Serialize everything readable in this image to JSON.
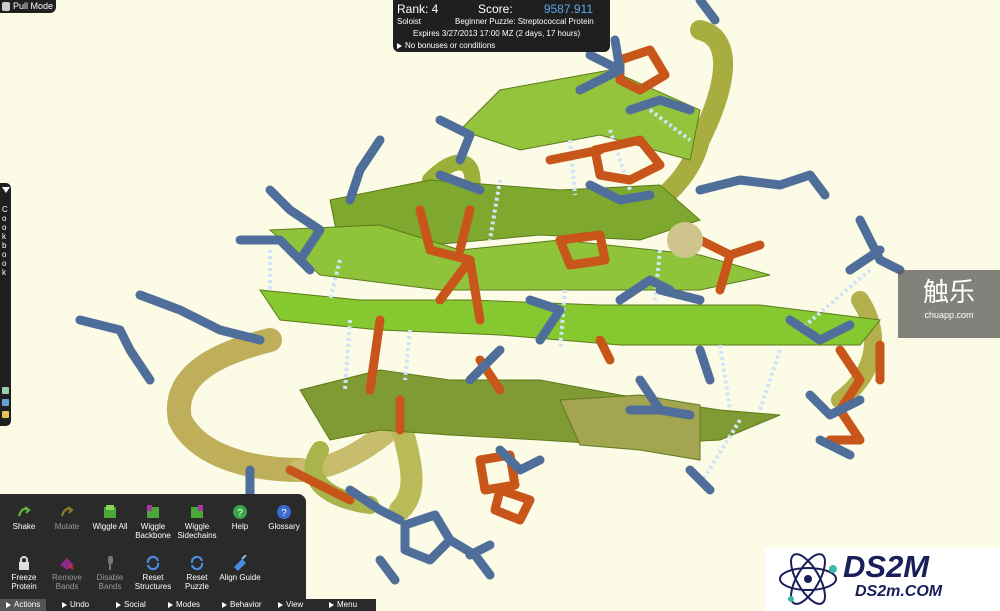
{
  "pull_mode": {
    "label": "Pull Mode"
  },
  "puzzle": {
    "rank_label": "Rank: 4",
    "score_label": "Score:",
    "score_value": "9587.911",
    "mode": "Soloist",
    "title": "Beginner Puzzle: Streptococcal Protein",
    "expires": "Expires 3/27/2013 17:00 MZ (2 days, 17 hours)",
    "bonus": "No bonuses or conditions"
  },
  "cookbook": {
    "label": "Cookbook"
  },
  "tools": [
    {
      "label": "Shake",
      "icon": "shake-icon"
    },
    {
      "label": "Mutate",
      "icon": "mutate-icon"
    },
    {
      "label": "Wiggle All",
      "icon": "wiggle-all-icon"
    },
    {
      "label": "Wiggle Backbone",
      "icon": "wiggle-backbone-icon"
    },
    {
      "label": "Wiggle Sidechains",
      "icon": "wiggle-sidechains-icon"
    },
    {
      "label": "Help",
      "icon": "help-icon"
    },
    {
      "label": "Glossary",
      "icon": "glossary-icon"
    },
    {
      "label": "Freeze Protein",
      "icon": "freeze-icon"
    },
    {
      "label": "Remove Bands",
      "icon": "remove-bands-icon"
    },
    {
      "label": "Disable Bands",
      "icon": "disable-bands-icon"
    },
    {
      "label": "Reset Structures",
      "icon": "reset-structures-icon"
    },
    {
      "label": "Reset Puzzle",
      "icon": "reset-puzzle-icon"
    },
    {
      "label": "Align Guide",
      "icon": "align-guide-icon"
    }
  ],
  "menus": {
    "actions": "Actions",
    "undo": "Undo",
    "social": "Social",
    "modes": "Modes",
    "behavior": "Behavior",
    "view": "View",
    "menu": "Menu"
  },
  "watermarks": {
    "chuapp_big": "触乐",
    "chuapp_small": "chuapp.com",
    "ds2m_big": "DS2M",
    "ds2m_small": "DS2m.COM"
  },
  "colors": {
    "background": "#fbfbe6",
    "sidechain_blue": "#4f6f9a",
    "sidechain_orange": "#c8561a",
    "sheet_green": "#8ec63a",
    "backbone_olive": "#a7ad3e",
    "hbond": "#cfe4f6",
    "score_blue": "#5aa8e8"
  }
}
